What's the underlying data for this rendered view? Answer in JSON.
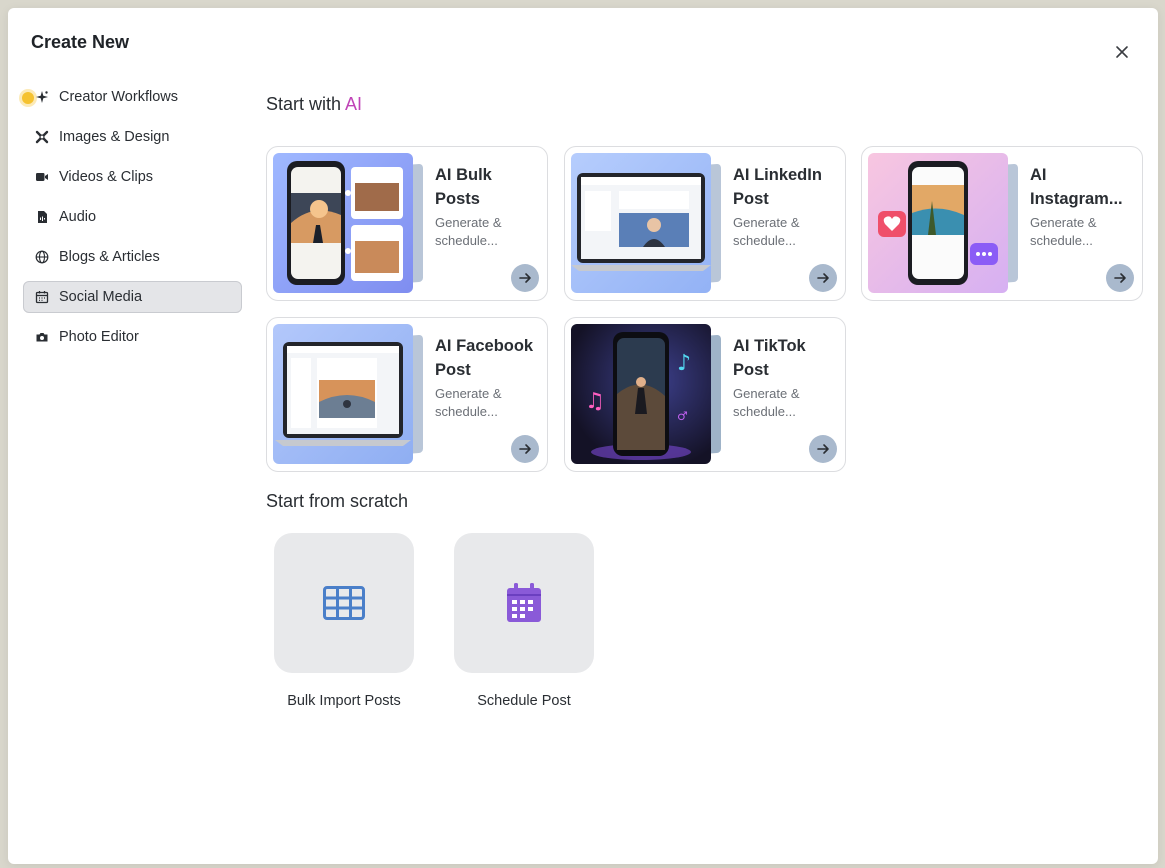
{
  "modal": {
    "title": "Create New"
  },
  "sidebar": {
    "items": [
      {
        "label": "Creator Workflows",
        "icon": "sparkle-icon"
      },
      {
        "label": "Images & Design",
        "icon": "design-tools-icon"
      },
      {
        "label": "Videos & Clips",
        "icon": "video-camera-icon"
      },
      {
        "label": "Audio",
        "icon": "audio-file-icon"
      },
      {
        "label": "Blogs & Articles",
        "icon": "globe-icon"
      },
      {
        "label": "Social Media",
        "icon": "calendar-icon",
        "active": true
      },
      {
        "label": "Photo Editor",
        "icon": "camera-icon"
      }
    ]
  },
  "ai_section": {
    "title_prefix": "Start with ",
    "title_ai": "AI"
  },
  "cards": [
    {
      "title": "AI Bulk Posts",
      "desc": "Generate & schedule..."
    },
    {
      "title": "AI LinkedIn Post",
      "desc": "Generate & schedule..."
    },
    {
      "title": "AI Instagram...",
      "desc": "Generate & schedule..."
    },
    {
      "title": "AI Facebook Post",
      "desc": "Generate & schedule..."
    },
    {
      "title": "AI TikTok Post",
      "desc": "Generate & schedule..."
    }
  ],
  "scratch_section": {
    "title": "Start from scratch"
  },
  "scratch_tiles": [
    {
      "label": "Bulk Import Posts",
      "icon": "grid-table-icon"
    },
    {
      "label": "Schedule Post",
      "icon": "calendar-icon"
    }
  ],
  "colors": {
    "accent_ai": "#c044b7",
    "grid_icon": "#4a7fc9",
    "calendar_icon": "#8a5ad8",
    "active_bg": "#e4e5e8"
  }
}
